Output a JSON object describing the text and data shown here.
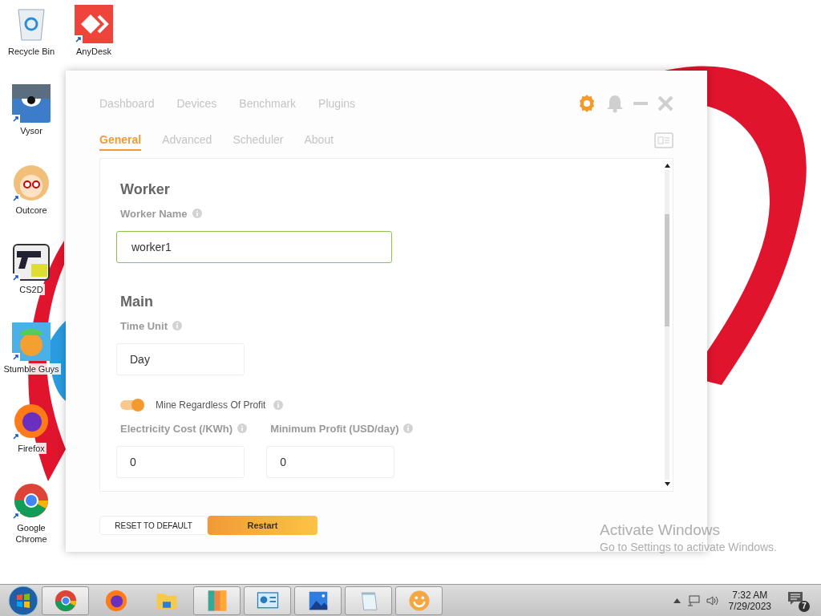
{
  "desktop_icons": [
    {
      "label": "Recycle Bin",
      "shortcut": false
    },
    {
      "label": "AnyDesk",
      "shortcut": true
    },
    {
      "label": "Vysor",
      "shortcut": true
    },
    {
      "label": "Outcore",
      "shortcut": true
    },
    {
      "label": "CS2D",
      "shortcut": true
    },
    {
      "label": "Stumble Guys",
      "shortcut": true
    },
    {
      "label": "Firefox",
      "shortcut": true
    },
    {
      "label": "Google Chrome",
      "shortcut": true
    }
  ],
  "window": {
    "nav": [
      {
        "label": "Dashboard",
        "selected": false
      },
      {
        "label": "Devices",
        "selected": false
      },
      {
        "label": "Benchmark",
        "selected": false
      },
      {
        "label": "Plugins",
        "selected": false
      }
    ],
    "settings_active": true,
    "tabs": [
      {
        "label": "General",
        "selected": true
      },
      {
        "label": "Advanced",
        "selected": false
      },
      {
        "label": "Scheduler",
        "selected": false
      },
      {
        "label": "About",
        "selected": false
      }
    ],
    "form": {
      "worker_heading": "Worker",
      "worker_name": {
        "label": "Worker Name",
        "value": "worker1",
        "focused": true
      },
      "main_heading": "Main",
      "time_unit": {
        "label": "Time Unit",
        "value": "Day"
      },
      "mine_toggle": {
        "label": "Mine Regardless Of Profit",
        "on": true
      },
      "electricity": {
        "label": "Electricity Cost (/KWh)",
        "value": "0"
      },
      "min_profit": {
        "label": "Minimum Profit (USD/day)",
        "value": "0"
      }
    },
    "reset_button": "RESET TO DEFAULT",
    "restart_button": "Restart"
  },
  "watermark": {
    "title": "Activate Windows",
    "text": "Go to Settings to activate Windows."
  },
  "taskbar": {
    "apps": [
      {
        "running": true
      },
      {
        "running": false
      },
      {
        "running": false
      },
      {
        "running": true
      },
      {
        "running": true
      },
      {
        "running": true
      },
      {
        "running": true
      },
      {
        "running": true
      }
    ],
    "time": "7:32 AM",
    "date": "7/29/2023",
    "notification_count": "7"
  }
}
